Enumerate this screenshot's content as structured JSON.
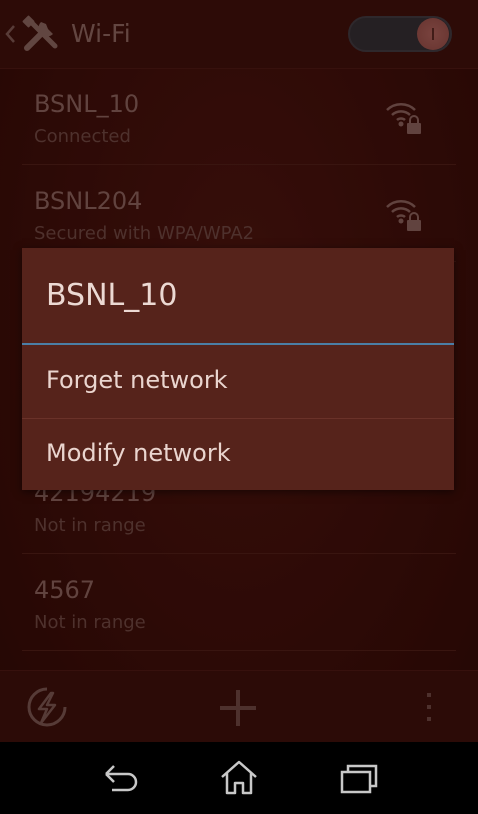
{
  "action_bar": {
    "title": "Wi-Fi",
    "wifi_toggle_on": true,
    "back_icon": "chevron-left-icon",
    "settings_icon": "tools-icon"
  },
  "networks": [
    {
      "name": "BSNL_10",
      "status": "Connected",
      "icon": "wifi-lock-icon"
    },
    {
      "name": "BSNL204",
      "status": "Secured with WPA/WPA2",
      "icon": "wifi-lock-icon"
    },
    {
      "name": "42194219",
      "status": "Not in range"
    },
    {
      "name": "4567",
      "status": "Not in range"
    }
  ],
  "dialog": {
    "title": "BSNL_10",
    "items": [
      {
        "label": "Forget network"
      },
      {
        "label": "Modify network"
      }
    ]
  },
  "bottom_bar": {
    "icons": [
      "refresh-icon",
      "add-icon",
      "overflow-menu-icon"
    ]
  },
  "system_nav": {
    "icons": [
      "back-icon",
      "home-icon",
      "recent-apps-icon"
    ]
  },
  "colors": {
    "background": "#3a0e0a",
    "dialog": "#56231b",
    "accent_rule": "#4b7ea6"
  }
}
